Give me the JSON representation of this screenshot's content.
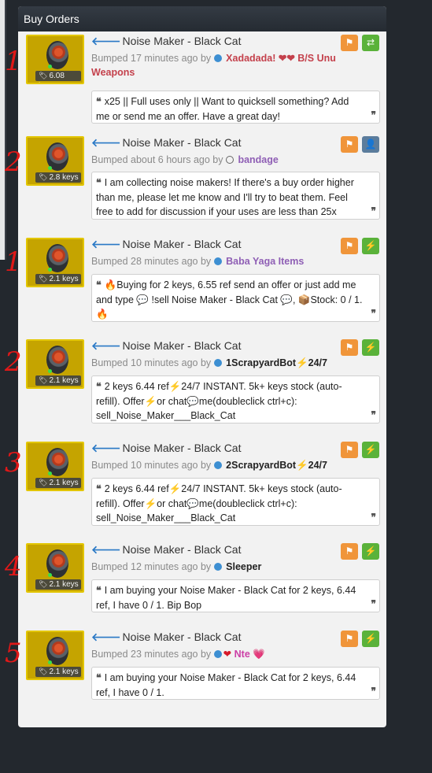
{
  "panel": {
    "title": "Buy Orders"
  },
  "colors": {
    "bump_text": "#8a8a8a",
    "arrow": "#2a79c6",
    "flag_button": "#f0953a",
    "lightning_button": "#5ab23a",
    "hand_annotation": "#e01818"
  },
  "entries": [
    {
      "annotation": "1",
      "price": "6.08 keys",
      "title": "Noise Maker - Black Cat",
      "bumped": "Bumped 17 minutes ago by",
      "user_prefix": "",
      "user": "Xadadada! ❤❤ B/S Unu Weapons",
      "user_color": "#c4414c",
      "status_icon": "circle-filled",
      "action_icon": "swap-icon",
      "message": "x25 || Full uses only || Want to quicksell something? Add me or send me an offer. Have a great day!"
    },
    {
      "annotation": "2",
      "price": "2.8 keys",
      "title": "Noise Maker - Black Cat",
      "bumped": "Bumped about 6 hours ago by",
      "user_prefix": "",
      "user": "bandage",
      "user_color": "#8f5fb5",
      "status_icon": "circle-hollow",
      "action_icon": "add-friend-icon",
      "message": "I am collecting noise makers! If there's a buy order higher than me, please let me know and I'll try to beat them. Feel free to add for discussion if your uses are less than 25x"
    },
    {
      "annotation": "1",
      "price": "2.1 keys",
      "title": "Noise Maker - Black Cat",
      "bumped": "Bumped 28 minutes ago by",
      "user_prefix": "",
      "user": "Baba Yaga Items",
      "user_color": "#8f5fb5",
      "status_icon": "circle-filled",
      "action_icon": "lightning-icon",
      "message": "🔥Buying for 2 keys, 6.55 ref send an offer or just add me and type 💬 !sell Noise Maker - Black Cat 💬, 📦Stock: 0 / 1. 🔥"
    },
    {
      "annotation": "2",
      "price": "2.1 keys",
      "title": "Noise Maker - Black Cat",
      "bumped": "Bumped 10 minutes ago by",
      "user_prefix": "",
      "user": "1ScrapyardBot⚡24/7",
      "user_color": "#222222",
      "status_icon": "circle-filled",
      "action_icon": "lightning-icon",
      "message": "2 keys 6.44 ref⚡24/7 INSTANT. 5k+ keys stock (auto-refill). Offer⚡or chat💬me(doubleclick ctrl+c): sell_Noise_Maker___Black_Cat"
    },
    {
      "annotation": "3",
      "price": "2.1 keys",
      "title": "Noise Maker - Black Cat",
      "bumped": "Bumped 10 minutes ago by",
      "user_prefix": "",
      "user": "2ScrapyardBot⚡24/7",
      "user_color": "#222222",
      "status_icon": "circle-filled",
      "action_icon": "lightning-icon",
      "message": "2 keys 6.44 ref⚡24/7 INSTANT. 5k+ keys stock (auto-refill). Offer⚡or chat💬me(doubleclick ctrl+c): sell_Noise_Maker___Black_Cat"
    },
    {
      "annotation": "4",
      "price": "2.1 keys",
      "title": "Noise Maker - Black Cat",
      "bumped": "Bumped 12 minutes ago by",
      "user_prefix": "",
      "user": "Sleeper",
      "user_color": "#222222",
      "status_icon": "circle-filled",
      "action_icon": "lightning-icon",
      "message": "I am buying your Noise Maker - Black Cat for 2 keys, 6.44 ref, I have 0 / 1. Bip Bop"
    },
    {
      "annotation": "5",
      "price": "2.1 keys",
      "title": "Noise Maker - Black Cat",
      "bumped": "Bumped 23 minutes ago by",
      "user_prefix": "❤",
      "user": "Nte 💗",
      "user_color": "#cc3fa6",
      "status_icon": "circle-filled",
      "action_icon": "lightning-icon",
      "message": "I am buying your Noise Maker - Black Cat for 2 keys, 6.44 ref, I have 0 / 1."
    }
  ]
}
